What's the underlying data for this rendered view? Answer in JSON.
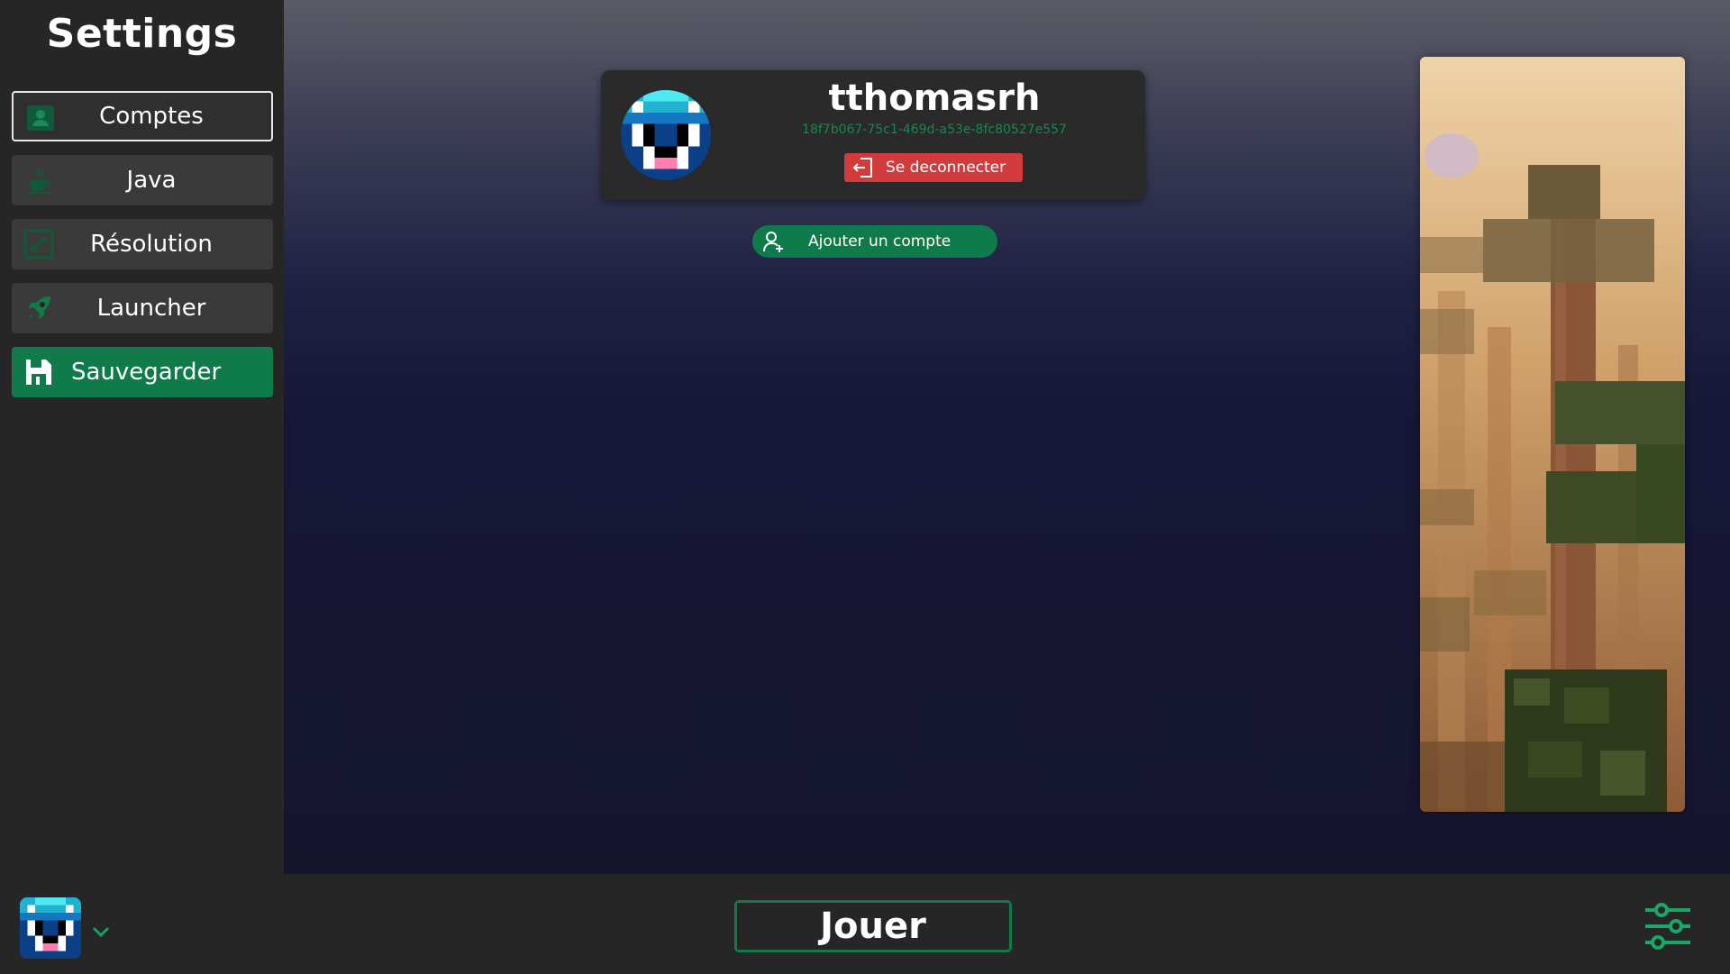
{
  "sidebar": {
    "title": "Settings",
    "items": [
      {
        "label": "Comptes",
        "icon": "account-card-icon",
        "active": true
      },
      {
        "label": "Java",
        "icon": "java-icon"
      },
      {
        "label": "Résolution",
        "icon": "resolution-icon"
      },
      {
        "label": "Launcher",
        "icon": "rocket-icon"
      },
      {
        "label": "Sauvegarder",
        "icon": "save-icon"
      }
    ]
  },
  "account": {
    "username": "tthomasrh",
    "uuid": "18f7b067-75c1-469d-a53e-8fc80527e557",
    "logout_label": "Se deconnecter"
  },
  "add_account_label": "Ajouter un compte",
  "bottombar": {
    "play_label": "Jouer"
  },
  "colors": {
    "accent_green": "#0f7a4a",
    "danger_red": "#d23b3b",
    "panel_dark": "#262626",
    "uuid_green": "#17884f"
  }
}
